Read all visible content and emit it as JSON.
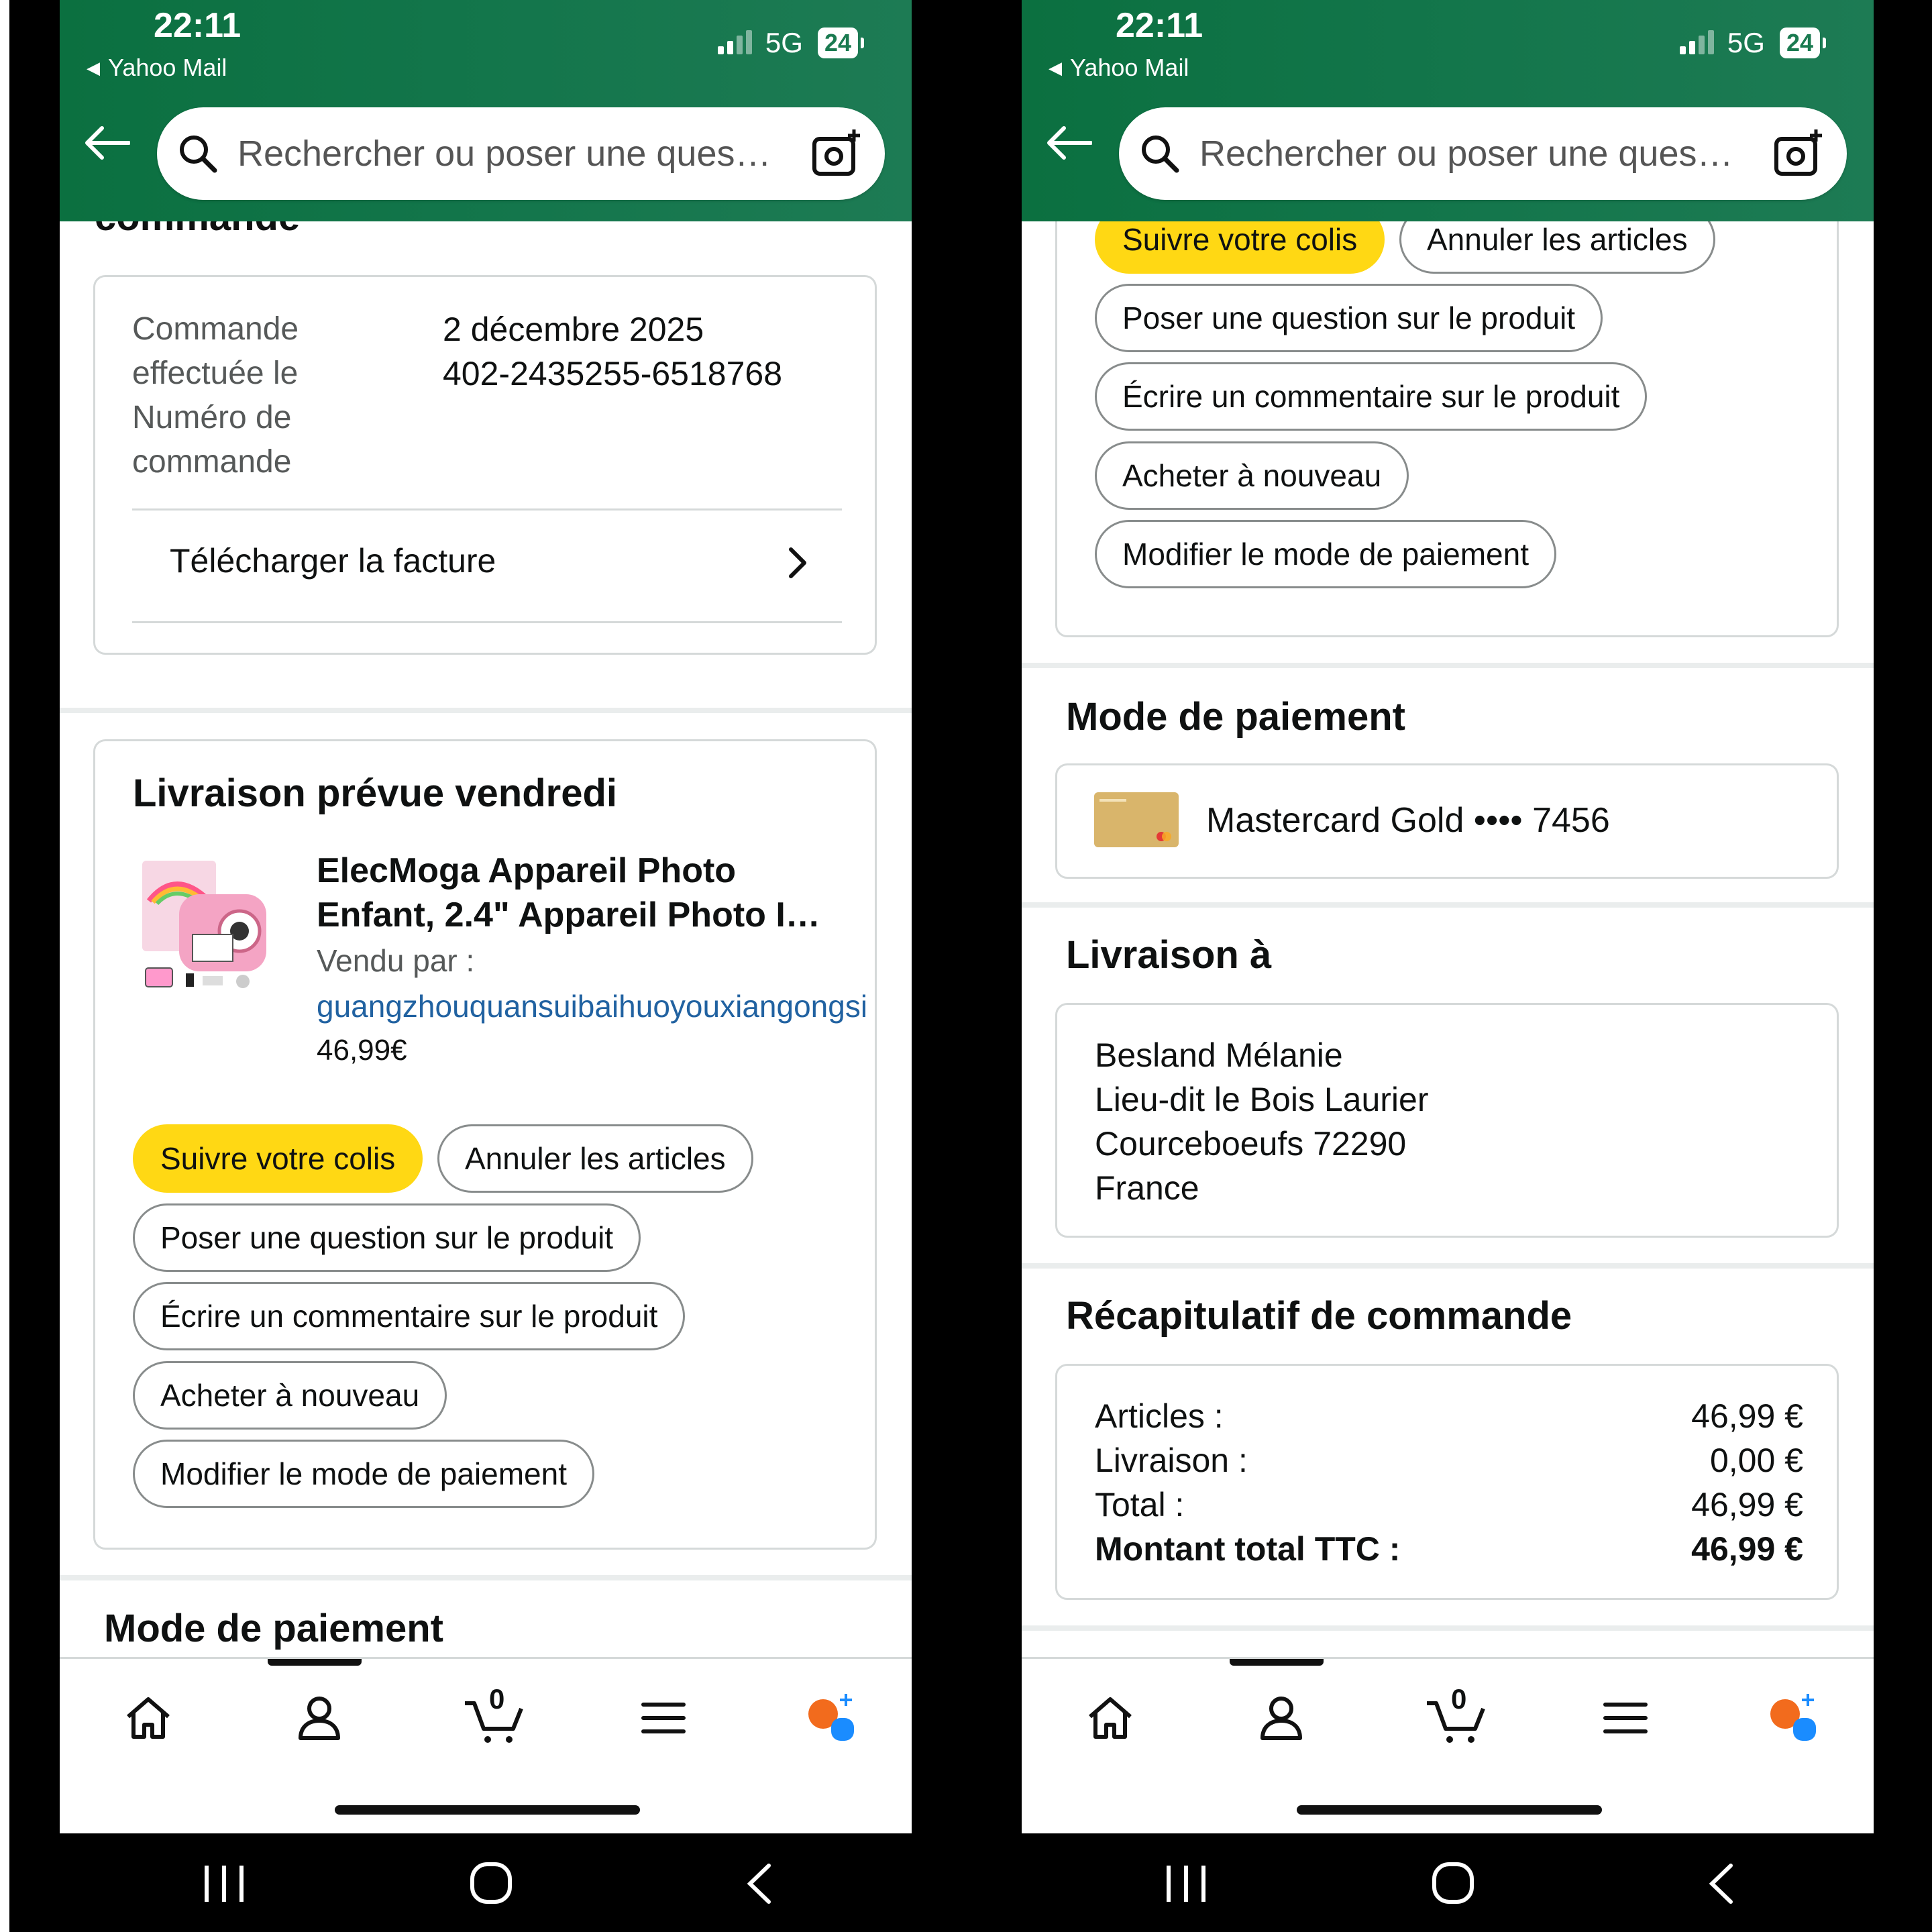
{
  "status_bar": {
    "time": "22:11",
    "back_app": "Yahoo Mail",
    "network": "5G",
    "battery": "24"
  },
  "search": {
    "placeholder": "Rechercher ou poser une ques…"
  },
  "order": {
    "clipped_heading": "commande",
    "placed_label": "Commande effectuée le",
    "number_label": "Numéro de commande",
    "date": "2 décembre 2025",
    "number": "402-2435255-6518768",
    "invoice_link": "Télécharger la facture"
  },
  "delivery": {
    "title": "Livraison prévue vendredi",
    "product_name": "ElecMoga Appareil Photo Enfant, 2.4\" Appareil Photo I…",
    "sold_by_label": "Vendu par  :",
    "seller": "guangzhouquansuibaihuoyouxiangongsi",
    "price": "46,99€"
  },
  "actions": {
    "track": "Suivre votre colis",
    "cancel": "Annuler les articles",
    "ask": "Poser une question sur le produit",
    "review": "Écrire un commentaire sur le produit",
    "buy_again": "Acheter à nouveau",
    "change_payment": "Modifier le mode de paiement"
  },
  "payment": {
    "title": "Mode de paiement",
    "card": "Mastercard Gold •••• 7456"
  },
  "shipping": {
    "title": "Livraison à",
    "name": "Besland Mélanie",
    "line1": "Lieu-dit le Bois Laurier",
    "line2": "Courceboeufs 72290",
    "country": "France"
  },
  "summary": {
    "title": "Récapitulatif de commande",
    "rows": [
      {
        "label": "Articles :",
        "value": "46,99 €"
      },
      {
        "label": "Livraison :",
        "value": "0,00 €"
      },
      {
        "label": "Total :",
        "value": "46,99 €"
      },
      {
        "label": "Montant total TTC :",
        "value": "46,99 €"
      }
    ]
  },
  "nav": {
    "cart_count": "0"
  },
  "colors": {
    "header_green": "#12754a",
    "button_yellow": "#ffd814",
    "link_blue": "#2162a1",
    "page_bg": "#000000"
  },
  "icons": [
    "back-arrow-icon",
    "search-icon",
    "camera-search-icon",
    "chevron-right-icon",
    "home-icon",
    "account-icon",
    "cart-icon",
    "menu-icon",
    "rufus-assistant-icon",
    "recent-apps-icon",
    "home-circle-icon",
    "system-back-icon"
  ]
}
